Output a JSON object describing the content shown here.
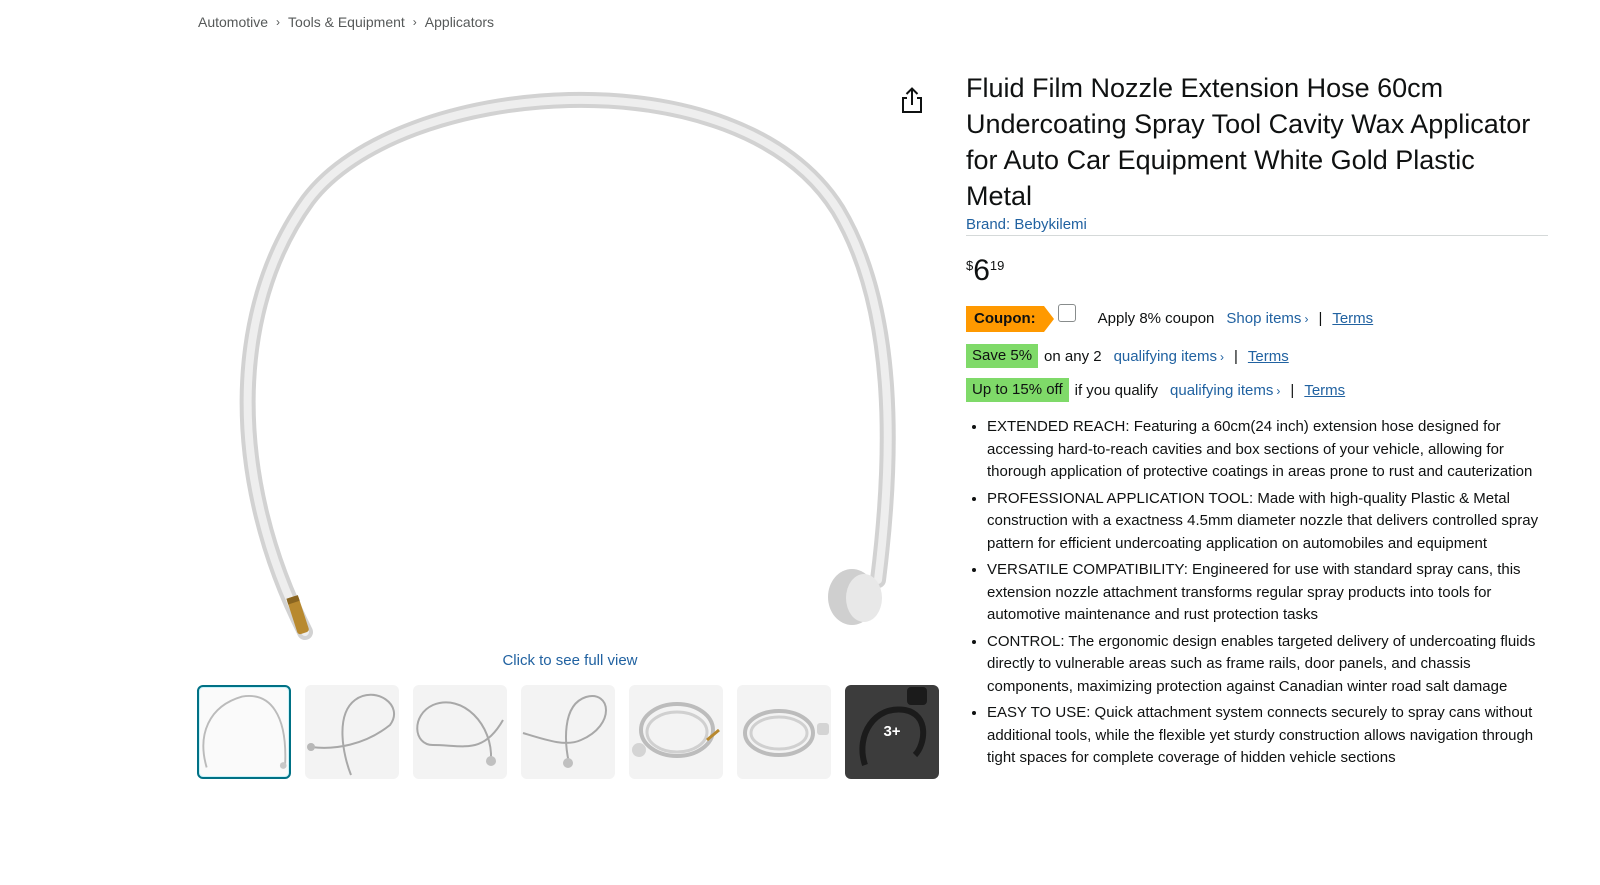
{
  "breadcrumb": {
    "items": [
      "Automotive",
      "Tools & Equipment",
      "Applicators"
    ],
    "separator": "›"
  },
  "gallery": {
    "share_icon": "share-icon",
    "full_view_label": "Click to see full view",
    "more_label": "3+",
    "thumbnail_count": 7
  },
  "product": {
    "title": "Fluid Film Nozzle Extension Hose 60cm Undercoating Spray Tool Cavity Wax Applicator for Auto Car Equipment White Gold Plastic Metal",
    "brand": "Brand: Bebykilemi",
    "price": {
      "symbol": "$",
      "whole": "6",
      "fraction": "19"
    }
  },
  "offers": {
    "coupon": {
      "badge": "Coupon:",
      "apply_label": "Apply 8% coupon",
      "shop_label": "Shop items",
      "terms": "Terms"
    },
    "save": {
      "badge": "Save 5%",
      "text": "on any 2",
      "link": "qualifying items",
      "terms": "Terms"
    },
    "upto": {
      "badge": "Up to 15% off",
      "text": "if you qualify",
      "link": "qualifying items",
      "terms": "Terms"
    }
  },
  "bullets": [
    "EXTENDED REACH: Featuring a 60cm(24 inch) extension hose designed for accessing hard-to-reach cavities and box sections of your vehicle, allowing for thorough application of protective coatings in areas prone to rust and cauterization",
    "PROFESSIONAL APPLICATION TOOL: Made with high-quality Plastic & Metal construction with a exactness 4.5mm diameter nozzle that delivers controlled spray pattern for efficient undercoating application on automobiles and equipment",
    "VERSATILE COMPATIBILITY: Engineered for use with standard spray cans, this extension nozzle attachment transforms regular spray products into tools for automotive maintenance and rust protection tasks",
    "CONTROL: The ergonomic design enables targeted delivery of undercoating fluids directly to vulnerable areas such as frame rails, door panels, and chassis components, maximizing protection against Canadian winter road salt damage",
    "EASY TO USE: Quick attachment system connects securely to spray cans without additional tools, while the flexible yet sturdy construction allows navigation through tight spaces for complete coverage of hidden vehicle sections"
  ],
  "colors": {
    "link": "#2162a1",
    "coupon_badge": "#ff9900",
    "deal_badge": "#7fda69",
    "thumb_active_border": "#007185"
  }
}
